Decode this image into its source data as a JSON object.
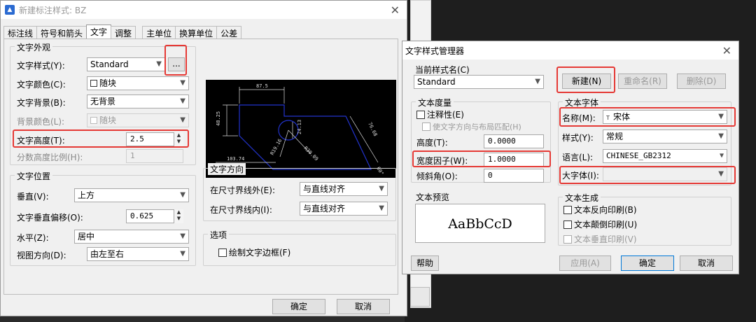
{
  "dlg1": {
    "title": "新建标注样式: BZ",
    "tabs": [
      "标注线",
      "符号和箭头",
      "文字",
      "调整",
      "主单位",
      "换算单位",
      "公差"
    ],
    "appearance": {
      "title": "文字外观",
      "style_label": "文字样式(Y):",
      "style_value": "Standard",
      "browse_label": "...",
      "color_label": "文字颜色(C):",
      "color_value": "随块",
      "bg_label": "文字背景(B):",
      "bg_value": "无背景",
      "bgcolor_label": "背景颜色(L):",
      "bgcolor_value": "随块",
      "height_label": "文字高度(T):",
      "height_value": "2.5",
      "fraction_label": "分数高度比例(H):",
      "fraction_value": "1"
    },
    "placement": {
      "title": "文字位置",
      "vertical_label": "垂直(V):",
      "vertical_value": "上方",
      "offset_label": "文字垂直偏移(O):",
      "offset_value": "0.625",
      "horizontal_label": "水平(Z):",
      "horizontal_value": "居中",
      "view_label": "视图方向(D):",
      "view_value": "由左至右"
    },
    "direction": {
      "title": "文字方向",
      "outside_label": "在尺寸界线外(E):",
      "outside_value": "与直线对齐",
      "inside_label": "在尺寸界线内(I):",
      "inside_value": "与直线对齐"
    },
    "options": {
      "title": "选项",
      "frame_label": "绘制文字边框(F)"
    },
    "preview_dims": [
      "87.5",
      "48.25",
      "24.13",
      "103.74",
      "R19.16",
      "R30.09",
      "76.68",
      "60°"
    ],
    "ok": "确定",
    "cancel": "取消"
  },
  "dlg2": {
    "title": "文字样式管理器",
    "current_label": "当前样式名(C)",
    "current_value": "Standard",
    "new_btn": "新建(N)",
    "rename_btn": "重命名(R)",
    "delete_btn": "删除(D)",
    "metrics": {
      "title": "文本度量",
      "annotative_label": "注释性(E)",
      "match_label": "使文字方向与布局匹配(H)",
      "height_label": "高度(T):",
      "height_value": "0.0000",
      "width_label": "宽度因子(W):",
      "width_value": "1.0000",
      "oblique_label": "倾斜角(O):",
      "oblique_value": "0"
    },
    "font": {
      "title": "文本字体",
      "name_label": "名称(M):",
      "name_value": "宋体",
      "font_icon_text": "T",
      "style_label": "样式(Y):",
      "style_value": "常规",
      "lang_label": "语言(L):",
      "lang_value": "CHINESE_GB2312",
      "bigfont_label": "大字体(I):",
      "bigfont_value": ""
    },
    "preview_title": "文本预览",
    "preview_text": "AaBbCcD",
    "gen": {
      "title": "文本生成",
      "reverse": "文本反向印刷(B)",
      "upside": "文本颠倒印刷(U)",
      "vertical": "文本垂直印刷(V)"
    },
    "help_btn": "帮助",
    "apply_btn": "应用(A)",
    "ok_btn": "确定",
    "cancel_btn": "取消"
  },
  "colors": {
    "highlight": "#e53935",
    "preview_lines": "#2233cc",
    "preview_bg": "#000000"
  }
}
